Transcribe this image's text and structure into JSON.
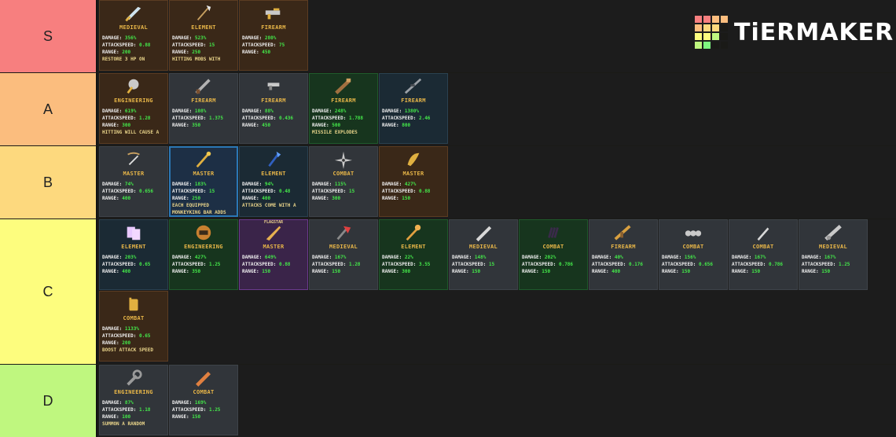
{
  "brand": {
    "logo_text": "TiERMAKER"
  },
  "tiers": [
    {
      "label": "S",
      "color": "#f77f7f",
      "items": [
        {
          "category": "MEDIEVAL",
          "icon": "sword-icon",
          "bg": "brown",
          "damage": "356%",
          "speed": "0.88",
          "range": "200",
          "note": "RESTORE 3 HP ON"
        },
        {
          "category": "ELEMENT",
          "icon": "spear-icon",
          "bg": "brown",
          "damage": "523%",
          "speed": "15",
          "range": "250",
          "note": "HITTING MOBS WITH"
        },
        {
          "category": "FIREARM",
          "icon": "gun-icon",
          "bg": "brown",
          "damage": "280%",
          "speed": "75",
          "range": "450",
          "note": ""
        }
      ]
    },
    {
      "label": "A",
      "color": "#fbbd7e",
      "items": [
        {
          "category": "ENGINEERING",
          "icon": "drill-icon",
          "bg": "brown",
          "damage": "619%",
          "speed": "1.28",
          "range": "300",
          "note": "HITTING WILL CAUSE A"
        },
        {
          "category": "FIREARM",
          "icon": "shotgun-icon",
          "bg": "gray",
          "damage": "108%",
          "speed": "1.375",
          "range": "350",
          "note": ""
        },
        {
          "category": "FIREARM",
          "icon": "pistol-icon",
          "bg": "gray",
          "damage": "88%",
          "speed": "0.436",
          "range": "450",
          "note": ""
        },
        {
          "category": "FIREARM",
          "icon": "launcher-icon",
          "bg": "green",
          "damage": "248%",
          "speed": "1.788",
          "range": "500",
          "note": "MISSILE EXPLODES"
        },
        {
          "category": "FIREARM",
          "icon": "sniper-icon",
          "bg": "teal",
          "damage": "1380%",
          "speed": "2.46",
          "range": "800",
          "note": ""
        }
      ]
    },
    {
      "label": "B",
      "color": "#fdd97e",
      "items": [
        {
          "category": "MASTER",
          "icon": "crossbow-icon",
          "bg": "gray",
          "damage": "74%",
          "speed": "0.656",
          "range": "400",
          "note": ""
        },
        {
          "category": "MASTER",
          "icon": "staff-icon",
          "bg": "blue",
          "damage": "183%",
          "speed": "15",
          "range": "250",
          "note": "EACH EQUIPPED",
          "note2": "MONKEYKING BAR ADDS"
        },
        {
          "category": "ELEMENT",
          "icon": "crystal-icon",
          "bg": "teal",
          "damage": "94%",
          "speed": "0.48",
          "range": "400",
          "note": "ATTACKS COME WITH A"
        },
        {
          "category": "COMBAT",
          "icon": "shuriken-icon",
          "bg": "gray",
          "damage": "115%",
          "speed": "15",
          "range": "300",
          "note": ""
        },
        {
          "category": "MASTER",
          "icon": "horn-icon",
          "bg": "brown",
          "damage": "427%",
          "speed": "0.88",
          "range": "150",
          "note": ""
        }
      ]
    },
    {
      "label": "C",
      "color": "#fdfd7e",
      "items": [
        {
          "category": "ELEMENT",
          "icon": "card-icon",
          "bg": "teal",
          "damage": "203%",
          "speed": "0.65",
          "range": "400",
          "note": ""
        },
        {
          "category": "ENGINEERING",
          "icon": "helmet-icon",
          "bg": "green",
          "damage": "427%",
          "speed": "1.25",
          "range": "350",
          "note": ""
        },
        {
          "category": "MASTER",
          "icon": "blade-icon",
          "bg": "purple",
          "tag": "FLAGSTAR",
          "damage": "649%",
          "speed": "0.88",
          "range": "150",
          "note": ""
        },
        {
          "category": "MEDIEVAL",
          "icon": "axe-icon",
          "bg": "gray",
          "damage": "167%",
          "speed": "1.28",
          "range": "150",
          "note": ""
        },
        {
          "category": "ELEMENT",
          "icon": "scepter-icon",
          "bg": "green",
          "damage": "22%",
          "speed": "3.55",
          "range": "300",
          "note": ""
        },
        {
          "category": "MEDIEVAL",
          "icon": "broadsword-icon",
          "bg": "gray",
          "damage": "148%",
          "speed": "15",
          "range": "150",
          "note": ""
        },
        {
          "category": "COMBAT",
          "icon": "claw-icon",
          "bg": "green",
          "damage": "202%",
          "speed": "0.786",
          "range": "150",
          "note": ""
        },
        {
          "category": "FIREARM",
          "icon": "rifle-icon",
          "bg": "gray",
          "damage": "40%",
          "speed": "0.176",
          "range": "400",
          "note": ""
        },
        {
          "category": "COMBAT",
          "icon": "knuckles-icon",
          "bg": "gray",
          "damage": "156%",
          "speed": "0.656",
          "range": "150",
          "note": ""
        },
        {
          "category": "COMBAT",
          "icon": "dagger-icon",
          "bg": "gray",
          "damage": "167%",
          "speed": "0.786",
          "range": "150",
          "note": ""
        },
        {
          "category": "MEDIEVAL",
          "icon": "lance-icon",
          "bg": "gray",
          "damage": "167%",
          "speed": "1.25",
          "range": "150",
          "note": ""
        },
        {
          "category": "COMBAT",
          "icon": "gauntlet-icon",
          "bg": "brown",
          "damage": "1133%",
          "speed": "0.65",
          "range": "200",
          "note": "BOOST ATTACK SPEED"
        }
      ]
    },
    {
      "label": "D",
      "color": "#bff77f",
      "items": [
        {
          "category": "ENGINEERING",
          "icon": "wrench-icon",
          "bg": "gray",
          "damage": "87%",
          "speed": "1.18",
          "range": "100",
          "note": "SUMMON A RANDOM"
        },
        {
          "category": "COMBAT",
          "icon": "bat-icon",
          "bg": "gray",
          "damage": "169%",
          "speed": "1.25",
          "range": "150",
          "note": ""
        }
      ]
    }
  ]
}
